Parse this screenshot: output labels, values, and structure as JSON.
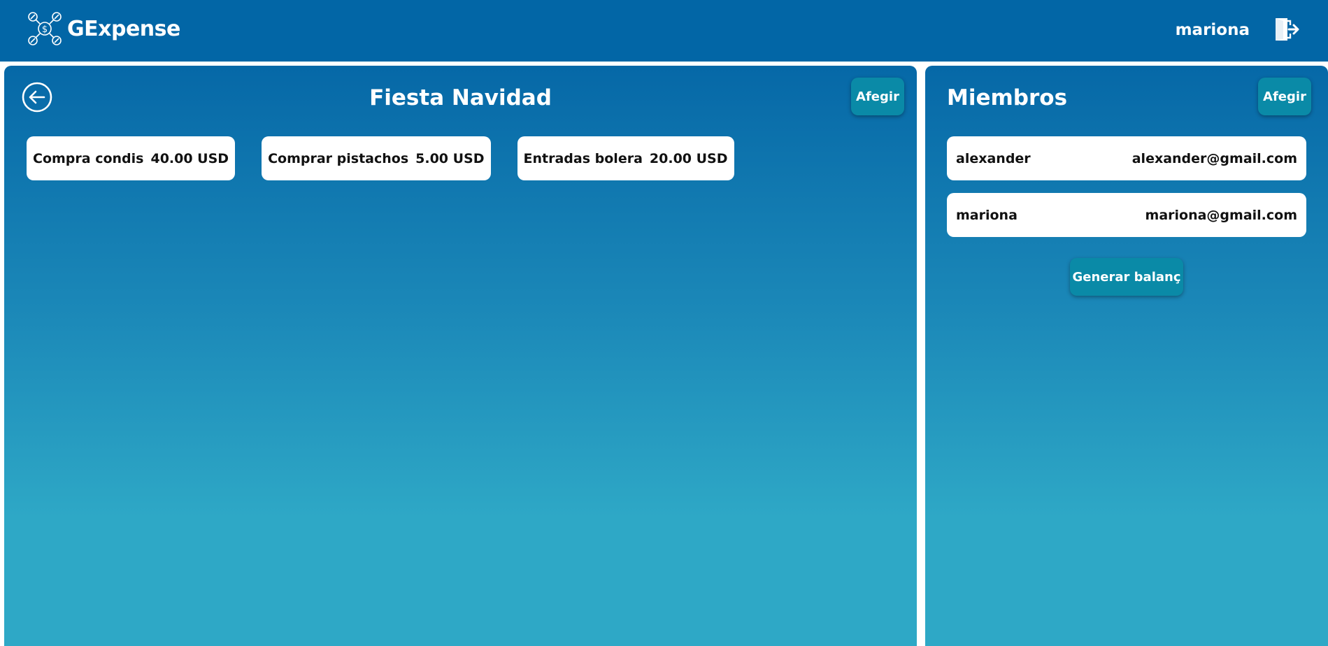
{
  "app": {
    "name": "GExpense",
    "logo_icon": "money-network-logo-icon",
    "accent": "#0266a6",
    "button_color": "#0a8aa7"
  },
  "header": {
    "username": "mariona",
    "logout_icon": "logout-door-icon"
  },
  "group": {
    "title": "Fiesta Navidad",
    "back_icon": "arrow-left-circle-icon",
    "add_label": "Afegir",
    "expenses": [
      {
        "name": "Compra condis",
        "amount": "40.00 USD"
      },
      {
        "name": "Comprar pistachos",
        "amount": "5.00 USD"
      },
      {
        "name": "Entradas bolera",
        "amount": "20.00 USD"
      }
    ]
  },
  "members": {
    "title": "Miembros",
    "add_label": "Afegir",
    "list": [
      {
        "name": "alexander",
        "email": "alexander@gmail.com"
      },
      {
        "name": "mariona",
        "email": "mariona@gmail.com"
      }
    ],
    "balance_label": "Generar balanç"
  }
}
